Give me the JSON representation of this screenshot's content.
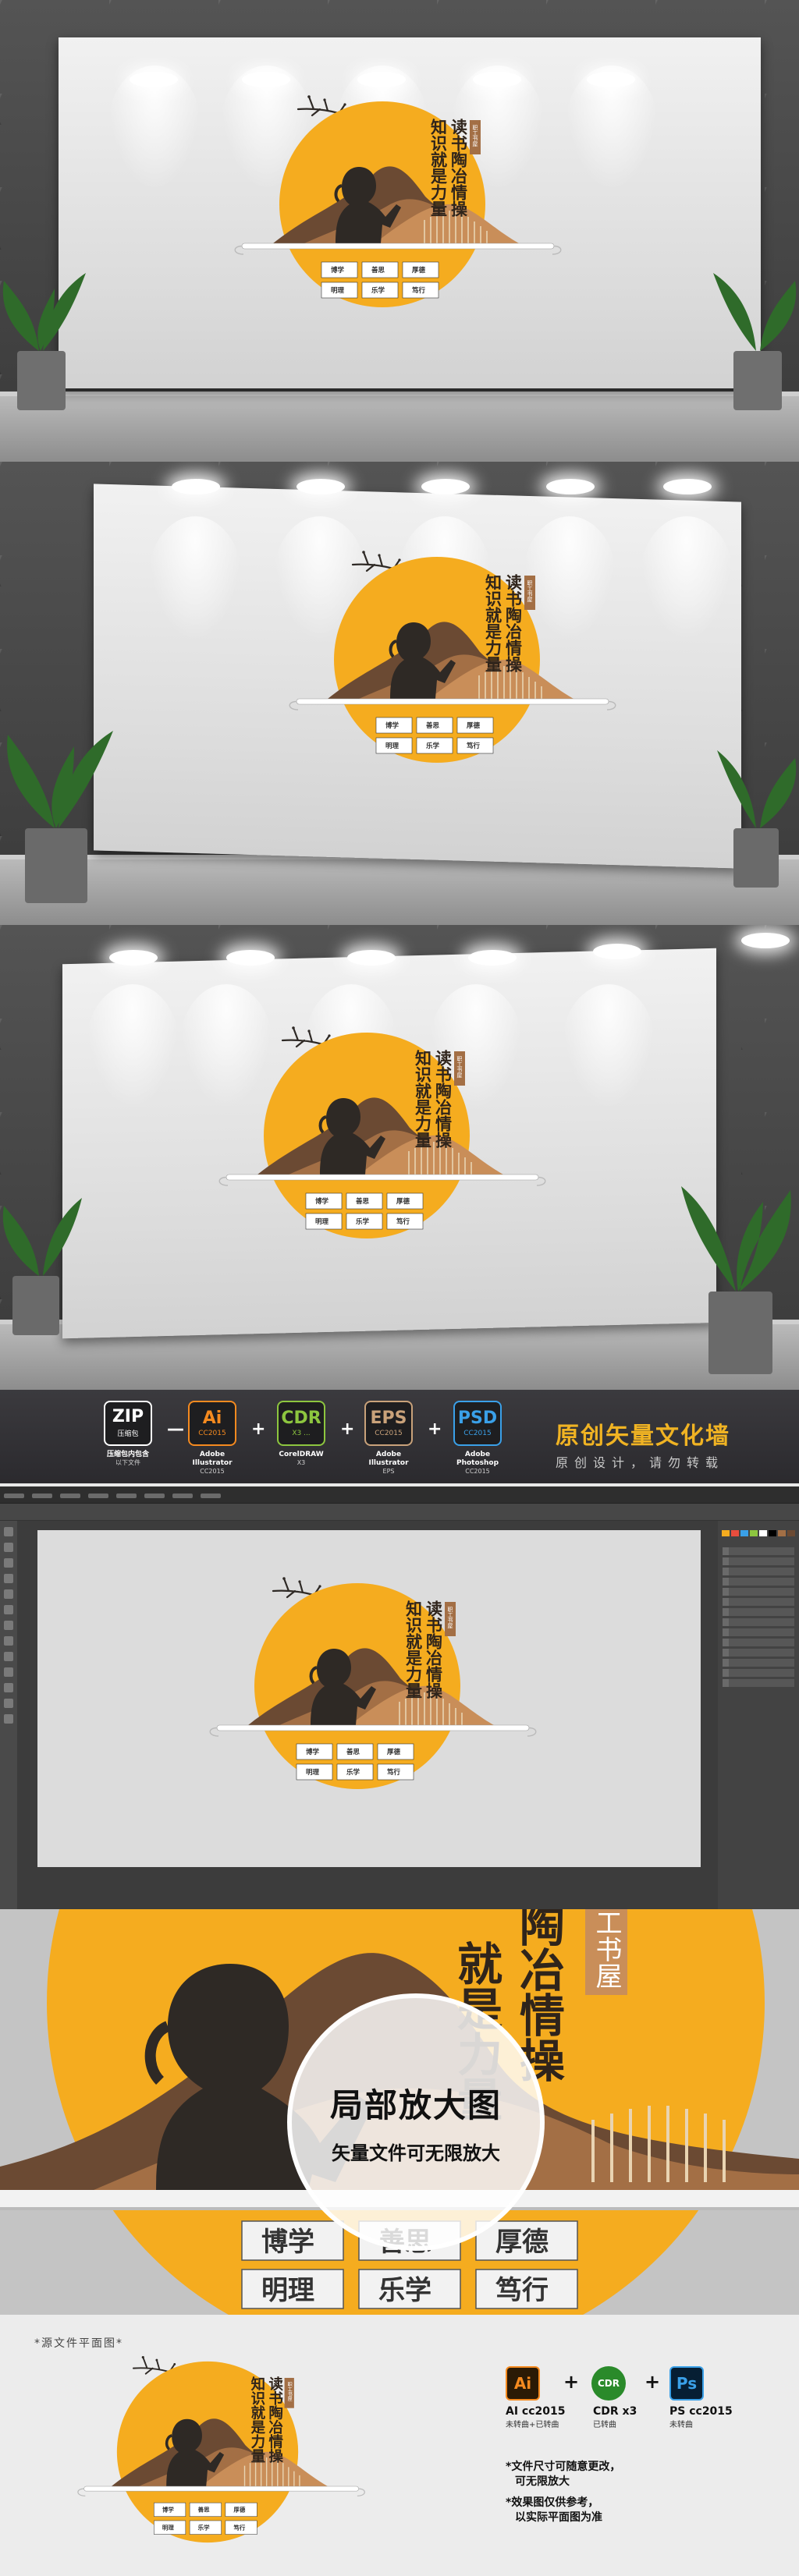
{
  "emblem": {
    "title_left": "知识就是力量",
    "title_right": "读书陶冶情操",
    "stamp": "职工书屋",
    "tiles_row1": [
      "博学",
      "善思",
      "厚德"
    ],
    "tiles_row2": [
      "明理",
      "乐学",
      "笃行"
    ]
  },
  "colors": {
    "circle": "#f5ac1f",
    "mountain_dark": "#6b4a33",
    "mountain_mid": "#a36f45",
    "mountain_light": "#c98e59",
    "silhouette": "#2e2925",
    "brand": "#f0b323"
  },
  "formats": [
    {
      "icon": "zip-icon",
      "abbr": "ZIP",
      "ver": "压缩包",
      "caption": "压缩包内包含",
      "sub": "以下文件",
      "color": "#ffffff"
    },
    {
      "icon": "illustrator-icon",
      "abbr": "Ai",
      "ver": "CC2015",
      "caption": "Adobe Illustrator",
      "sub": "CC2015",
      "color": "#f58a1f"
    },
    {
      "icon": "coreldraw-icon",
      "abbr": "CDR",
      "ver": "X3 ...",
      "caption": "CorelDRAW",
      "sub": "X3",
      "color": "#8dc63f"
    },
    {
      "icon": "eps-icon",
      "abbr": "EPS",
      "ver": "CC2015",
      "caption": "Adobe Illustrator",
      "sub": "EPS",
      "color": "#c9a27a"
    },
    {
      "icon": "photoshop-icon",
      "abbr": "PSD",
      "ver": "CC2015",
      "caption": "Adobe Photoshop",
      "sub": "CC2015",
      "color": "#3aa0e8"
    }
  ],
  "format_separators": [
    "—",
    "+",
    "+",
    "+"
  ],
  "brand": {
    "title": "原创矢量文化墙",
    "subtitle": "原创设计，请勿转载"
  },
  "zoom": {
    "title": "局部放大图",
    "subtitle": "矢量文件可无限放大",
    "text_left": "就是力量",
    "text_right": "陶冶情操",
    "stamp": "工书屋",
    "tiles_row1": [
      "博学",
      "善思",
      "厚德"
    ],
    "tiles_row2": [
      "明理",
      "乐学",
      "笃行"
    ]
  },
  "flat": {
    "label": "*源文件平面图*",
    "software": [
      {
        "icon": "illustrator-icon",
        "abbr": "Ai",
        "caption": "AI cc2015",
        "sub": "未转曲+已转曲"
      },
      {
        "icon": "coreldraw-icon",
        "abbr": "CDR",
        "caption": "CDR x3",
        "sub": "已转曲"
      },
      {
        "icon": "photoshop-icon",
        "abbr": "Ps",
        "caption": "PS cc2015",
        "sub": "未转曲"
      }
    ],
    "notes": [
      "*文件尺寸可随意更改，",
      "可无限放大",
      "*效果图仅供参考，",
      "以实际平面图为准"
    ]
  }
}
